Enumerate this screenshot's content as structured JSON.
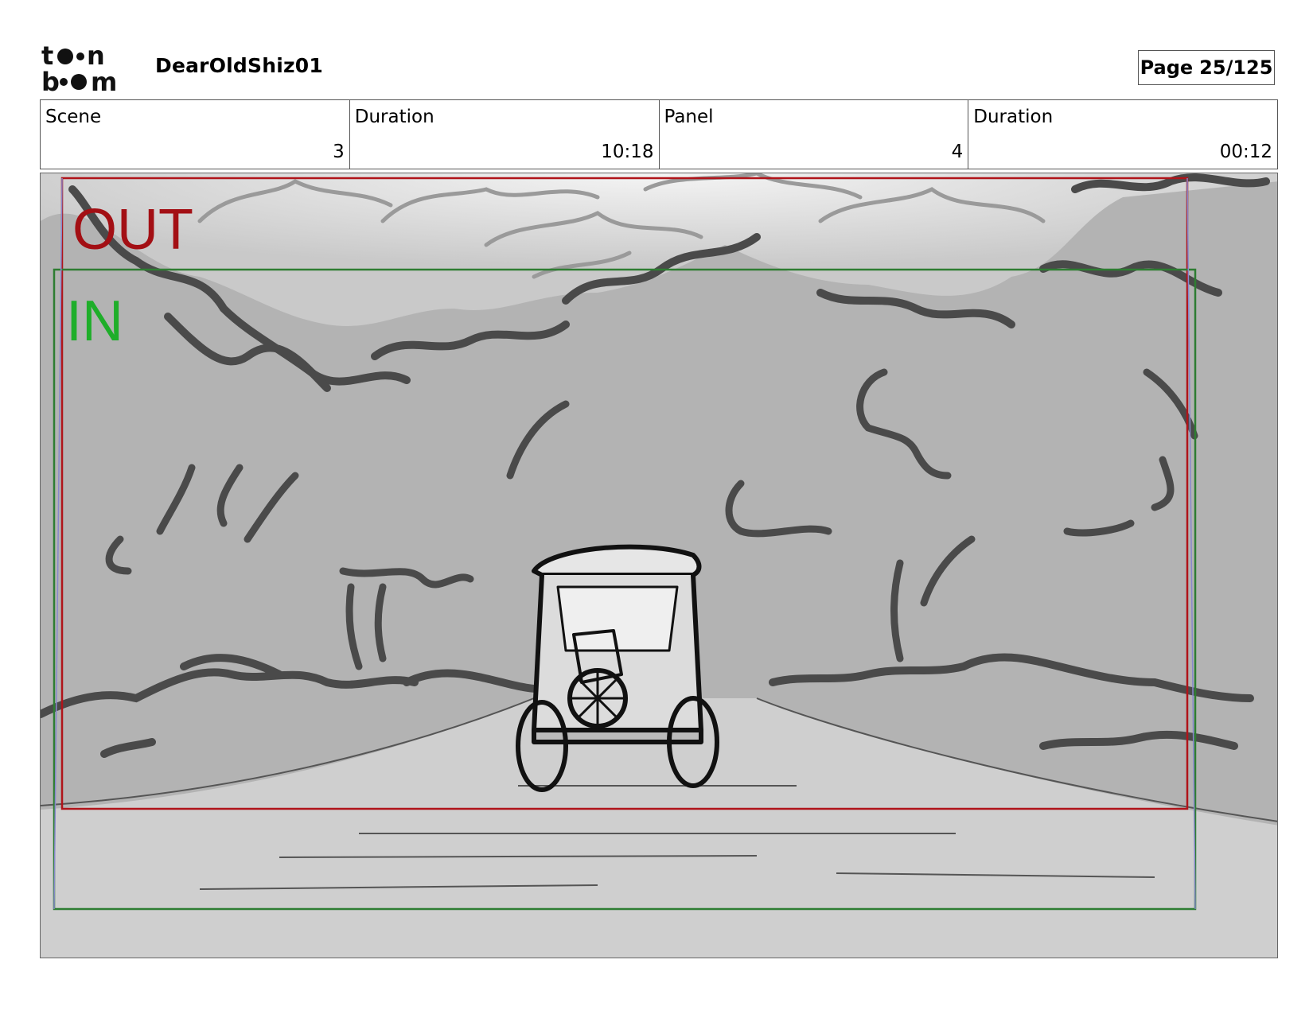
{
  "header": {
    "logo_text": "toon boom",
    "project_title": "DearOldShiz01",
    "page_label": "Page",
    "page_value": "25/125"
  },
  "info": [
    {
      "label": "Scene",
      "value": "3"
    },
    {
      "label": "Duration",
      "value": "10:18"
    },
    {
      "label": "Panel",
      "value": "4"
    },
    {
      "label": "Duration",
      "value": "00:12"
    }
  ],
  "panel": {
    "out_label": "OUT",
    "in_label": "IN",
    "out_frame_color": "#b0141a",
    "in_frame_color": "#2e7d32",
    "label_out_color": "#a30f14",
    "label_in_color": "#1fae2a"
  }
}
